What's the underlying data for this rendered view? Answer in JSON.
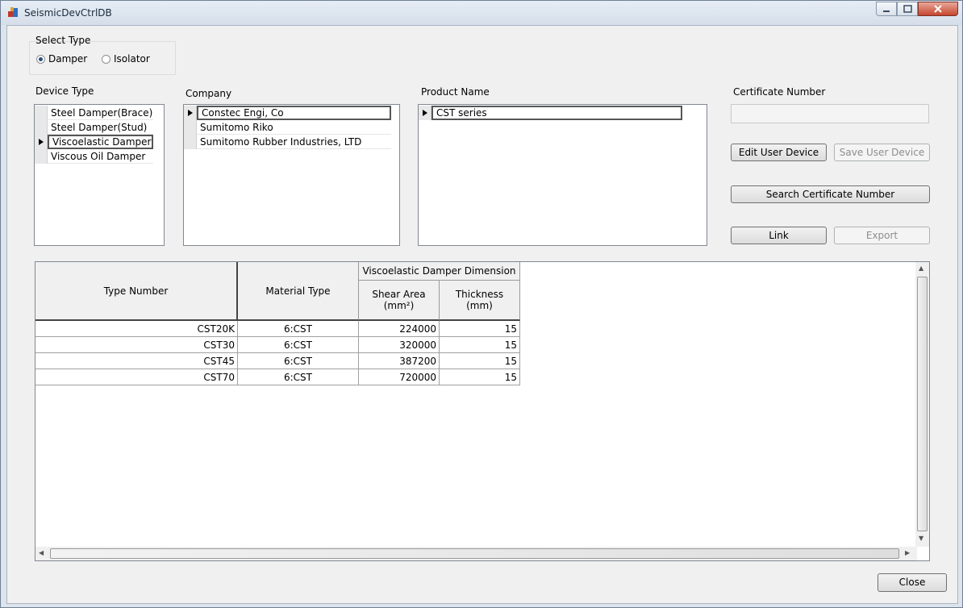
{
  "window": {
    "title": "SeismicDevCtrlDB"
  },
  "select_type": {
    "label": "Select Type",
    "options": [
      "Damper",
      "Isolator"
    ],
    "selected": "Damper"
  },
  "device_type": {
    "label": "Device Type",
    "items": [
      "Steel Damper(Brace)",
      "Steel Damper(Stud)",
      "Viscoelastic Damper",
      "Viscous Oil Damper"
    ],
    "selected_index": 2
  },
  "company": {
    "label": "Company",
    "items": [
      "Constec Engi, Co",
      "Sumitomo Riko",
      "Sumitomo Rubber Industries, LTD"
    ],
    "selected_index": 0
  },
  "product_name": {
    "label": "Product Name",
    "items": [
      "CST series"
    ],
    "selected_index": 0
  },
  "certificate": {
    "label": "Certificate Number",
    "value": ""
  },
  "buttons": {
    "edit_user_device": "Edit User Device",
    "save_user_device": "Save User Device",
    "search_certificate": "Search Certificate Number",
    "link": "Link",
    "export": "Export",
    "close": "Close"
  },
  "table": {
    "columns": {
      "type_number": "Type Number",
      "material_type": "Material Type",
      "group": "Viscoelastic Damper Dimension",
      "shear_area": "Shear Area\n(mm²)",
      "thickness": "Thickness\n(mm)"
    },
    "rows": [
      {
        "type_number": "CST20K",
        "material_type": "6:CST",
        "shear_area": "224000",
        "thickness": "15"
      },
      {
        "type_number": "CST30",
        "material_type": "6:CST",
        "shear_area": "320000",
        "thickness": "15"
      },
      {
        "type_number": "CST45",
        "material_type": "6:CST",
        "shear_area": "387200",
        "thickness": "15"
      },
      {
        "type_number": "CST70",
        "material_type": "6:CST",
        "shear_area": "720000",
        "thickness": "15"
      }
    ]
  }
}
